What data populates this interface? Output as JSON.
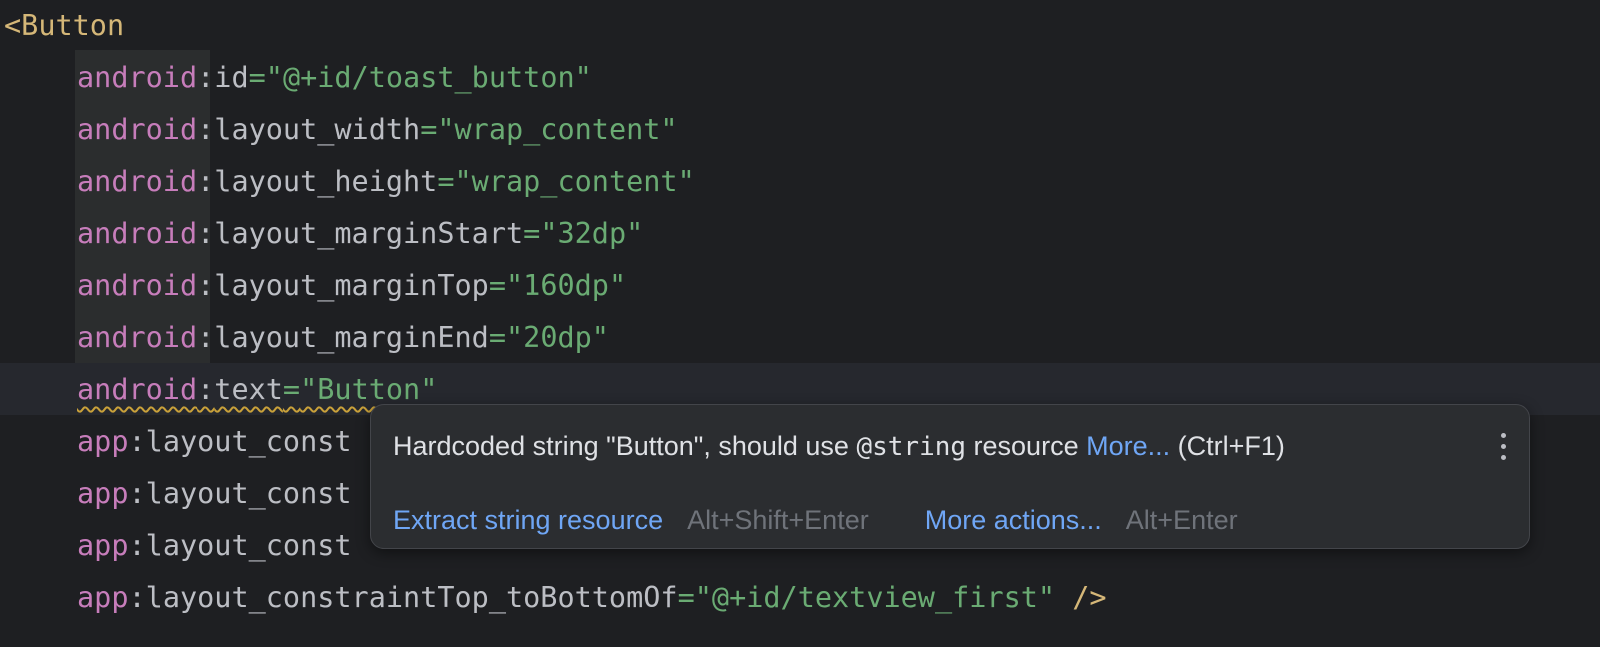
{
  "code": {
    "open_tag_lt": "<",
    "open_tag_name": "Button",
    "lines": [
      {
        "ns": "android",
        "colon": ":",
        "attr": "id",
        "eq": "=",
        "value": "\"@+id/toast_button\""
      },
      {
        "ns": "android",
        "colon": ":",
        "attr": "layout_width",
        "eq": "=",
        "value": "\"wrap_content\""
      },
      {
        "ns": "android",
        "colon": ":",
        "attr": "layout_height",
        "eq": "=",
        "value": "\"wrap_content\""
      },
      {
        "ns": "android",
        "colon": ":",
        "attr": "layout_marginStart",
        "eq": "=",
        "value": "\"32dp\""
      },
      {
        "ns": "android",
        "colon": ":",
        "attr": "layout_marginTop",
        "eq": "=",
        "value": "\"160dp\""
      },
      {
        "ns": "android",
        "colon": ":",
        "attr": "layout_marginEnd",
        "eq": "=",
        "value": "\"20dp\""
      },
      {
        "ns": "android",
        "colon": ":",
        "attr": "text",
        "eq": "=",
        "value": "\"Button\""
      },
      {
        "ns": "app",
        "colon": ":",
        "attr": "layout_const"
      },
      {
        "ns": "app",
        "colon": ":",
        "attr": "layout_const"
      },
      {
        "ns": "app",
        "colon": ":",
        "attr": "layout_const"
      },
      {
        "ns": "app",
        "colon": ":",
        "attr": "layout_constraintTop_toBottomOf",
        "eq": "=",
        "value": "\"@+id/textview_first\"",
        "close": "/>"
      }
    ]
  },
  "popup": {
    "message_start": "Hardcoded string \"Button\", should use ",
    "message_code": "@string",
    "message_end": " resource ",
    "more_link": "More...",
    "more_shortcut": " (Ctrl+F1)",
    "kebab_icon": "more-vertical-icon",
    "actions": [
      {
        "label": "Extract string resource",
        "shortcut": "Alt+Shift+Enter"
      },
      {
        "label": "More actions...",
        "shortcut": "Alt+Enter"
      }
    ]
  },
  "colors": {
    "background": "#1e1f22",
    "tag": "#d5b778",
    "namespace": "#c77dbb",
    "attribute": "#bcbec4",
    "string": "#6aab73",
    "link": "#6fa6f5",
    "warning_underline": "#c9a13a"
  }
}
